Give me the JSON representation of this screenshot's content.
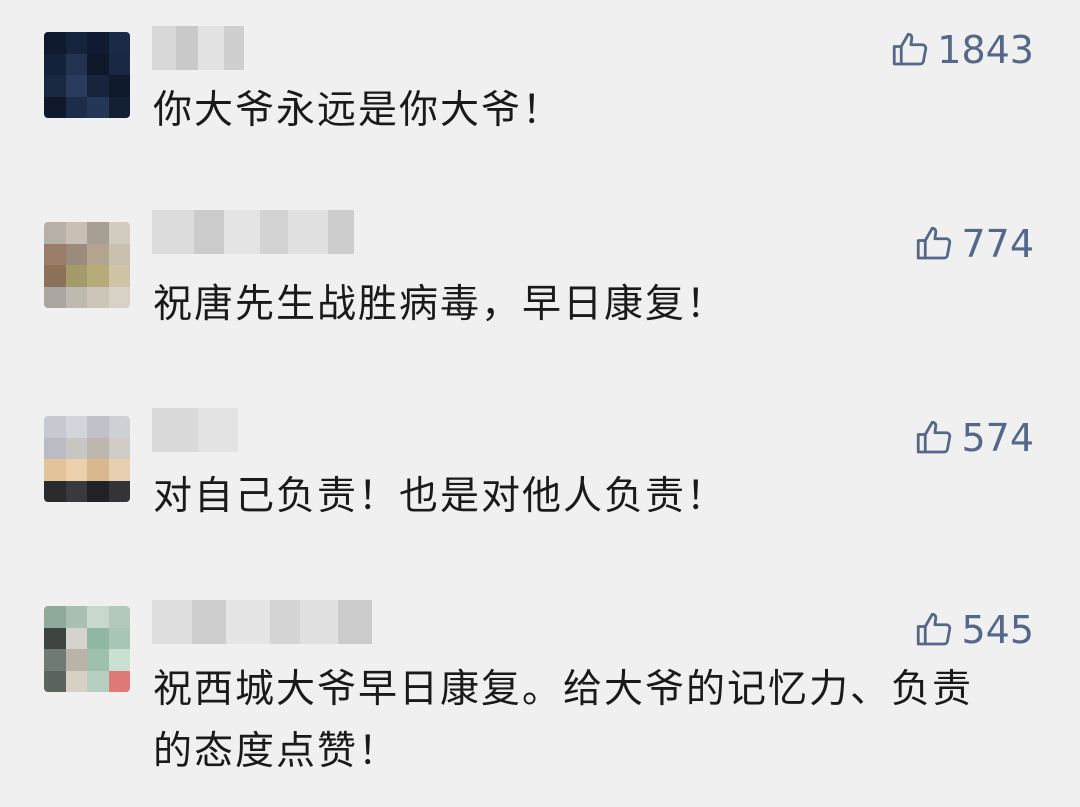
{
  "comments": [
    {
      "text": "你大爷永远是你大爷！",
      "likes": "1843",
      "like_icon": "thumbs-up-icon"
    },
    {
      "text": "祝唐先生战胜病毒，早日康复！",
      "likes": "774",
      "like_icon": "thumbs-up-icon"
    },
    {
      "text": "对自己负责！也是对他人负责！",
      "likes": "574",
      "like_icon": "thumbs-up-icon"
    },
    {
      "text": "祝西城大爷早日康复。给大爷的记忆力、负责的态度点赞！",
      "likes": "545",
      "like_icon": "thumbs-up-icon"
    }
  ],
  "colors": {
    "background": "#f0f0f0",
    "like_count": "#55688a",
    "comment_text": "#1a1a1a"
  }
}
